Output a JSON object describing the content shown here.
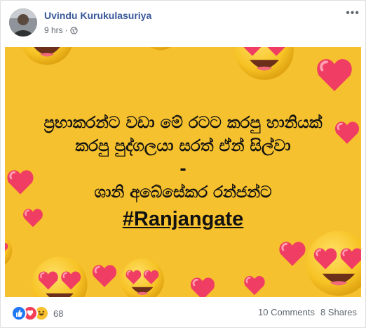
{
  "post": {
    "author": "Uvindu Kurukulasuriya",
    "timestamp": "9 hrs",
    "audience_icon": "globe-icon",
    "options_icon": "more-options-icon"
  },
  "image": {
    "background_color": "#f6c12e",
    "lines": [
      "ප්‍රභාකරන්ට වඩා මේ රටට කරපු හානියක්",
      "කරපු පුද්ගලයා සරත් ඒන් සිල්වා",
      "-",
      "ශානි අබේසේකර රන්ජන්ට"
    ],
    "hashtag": "#Ranjangate"
  },
  "footer": {
    "reaction_icons": [
      "like-icon",
      "love-icon",
      "haha-icon"
    ],
    "reaction_count": "68",
    "comments": "10 Comments",
    "shares": "8 Shares"
  }
}
